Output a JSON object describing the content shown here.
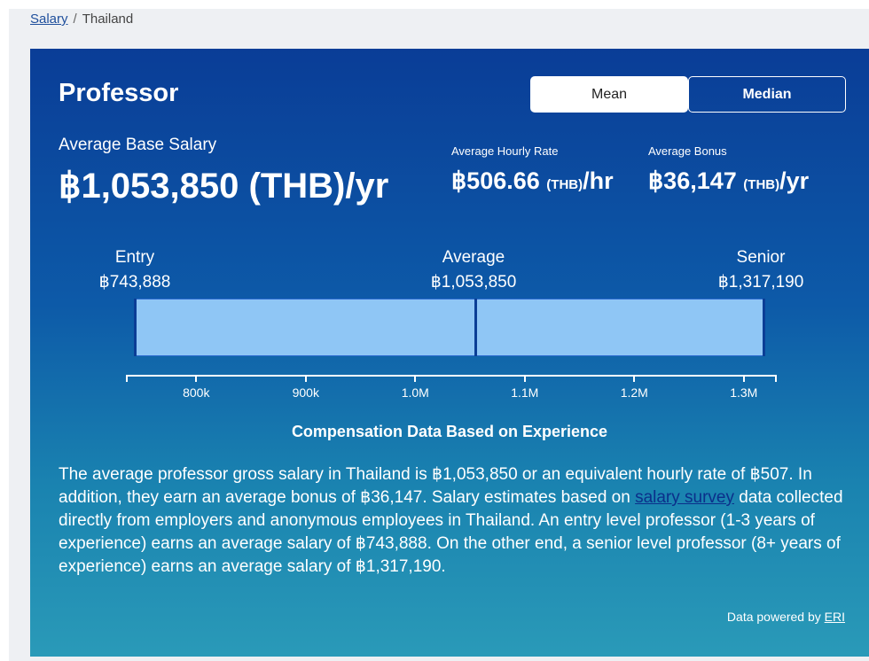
{
  "breadcrumb": {
    "link": "Salary",
    "separator": "/",
    "current": "Thailand"
  },
  "card": {
    "title": "Professor",
    "toggle": {
      "mean": "Mean",
      "median": "Median",
      "selected": "Mean"
    },
    "base": {
      "label": "Average Base Salary",
      "value": "฿1,053,850 (THB)/yr"
    },
    "hourly": {
      "label": "Average Hourly Rate",
      "amount": "฿506.66",
      "unit": "(THB)",
      "suffix": "/hr"
    },
    "bonus": {
      "label": "Average Bonus",
      "amount": "฿36,147",
      "unit": "(THB)",
      "suffix": "/yr"
    }
  },
  "levels": {
    "entry": {
      "label": "Entry",
      "value": "฿743,888"
    },
    "average": {
      "label": "Average",
      "value": "฿1,053,850"
    },
    "senior": {
      "label": "Senior",
      "value": "฿1,317,190"
    }
  },
  "chart_data": {
    "type": "bar",
    "title": "",
    "range": {
      "entry": 743888,
      "average": 1053850,
      "senior": 1317190
    },
    "xlim": [
      720000,
      1340000
    ],
    "ticks": [
      {
        "value": 800000,
        "label": "800k"
      },
      {
        "value": 900000,
        "label": "900k"
      },
      {
        "value": 1000000,
        "label": "1.0M"
      },
      {
        "value": 1100000,
        "label": "1.1M"
      },
      {
        "value": 1200000,
        "label": "1.2M"
      },
      {
        "value": 1300000,
        "label": "1.3M"
      }
    ],
    "caption": "Compensation Data Based on Experience"
  },
  "description": {
    "part1": "The average professor gross salary in Thailand is ฿1,053,850 or an equivalent hourly rate of ฿507. In addition, they earn an average bonus of ฿36,147. Salary estimates based on ",
    "link": "salary survey",
    "part2": " data collected directly from employers and anonymous employees in Thailand. An entry level professor (1-3 years of experience) earns an average salary of ฿743,888. On the other end, a senior level professor (8+ years of experience) earns an average salary of ฿1,317,190."
  },
  "powered": {
    "text": "Data powered by ",
    "link": "ERI"
  }
}
